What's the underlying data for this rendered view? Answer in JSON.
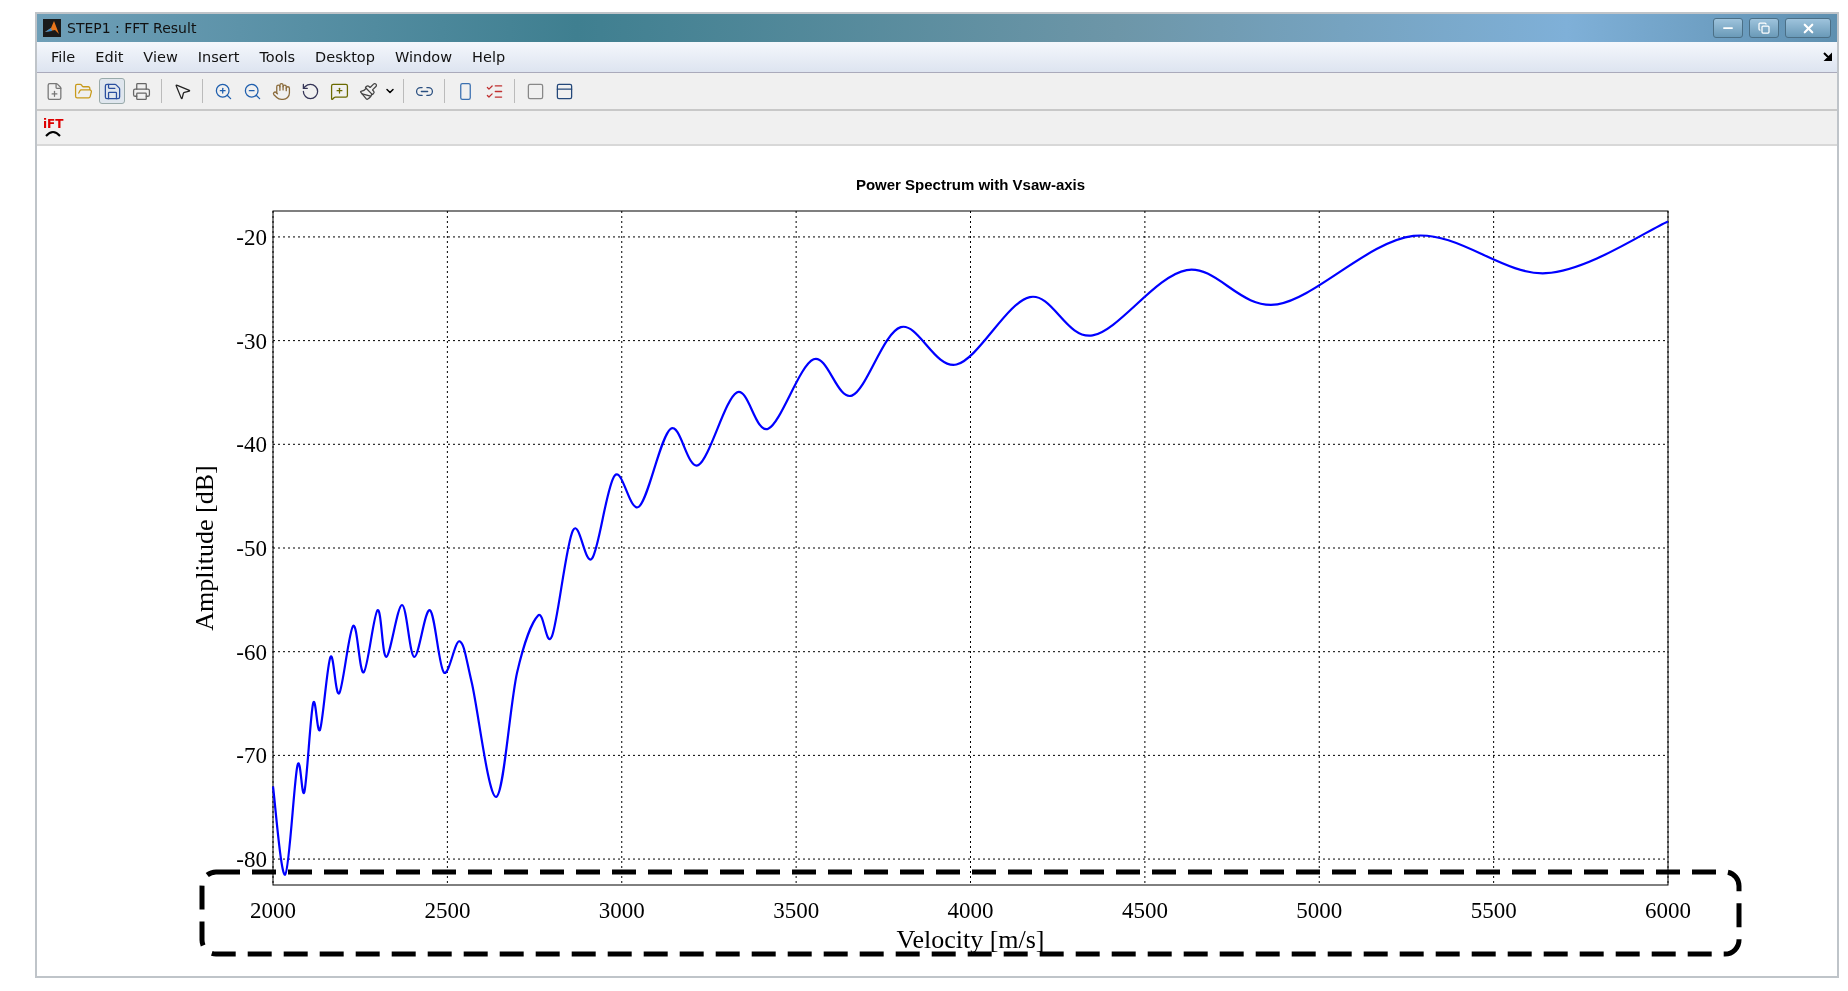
{
  "window": {
    "title": "STEP1 : FFT Result"
  },
  "menu": [
    "File",
    "Edit",
    "View",
    "Insert",
    "Tools",
    "Desktop",
    "Window",
    "Help"
  ],
  "toolbar2": {
    "logo_text": "iFT"
  },
  "figure": {
    "chart_data": {
      "type": "line",
      "title": "Power Spectrum with Vsaw-axis",
      "xlabel": "Velocity [m/s]",
      "ylabel": "Amplitude [dB]",
      "x": [
        2000,
        2035,
        2070,
        2090,
        2115,
        2135,
        2165,
        2190,
        2230,
        2260,
        2300,
        2325,
        2370,
        2405,
        2450,
        2490,
        2535,
        2570,
        2640,
        2700,
        2760,
        2800,
        2860,
        2915,
        2980,
        3050,
        3140,
        3220,
        3330,
        3420,
        3550,
        3660,
        3800,
        3960,
        4170,
        4350,
        4620,
        4880,
        5270,
        5650,
        6000
      ],
      "series": [
        {
          "color": "#0000ff",
          "values": [
            -73,
            -81.5,
            -71,
            -73.5,
            -65,
            -67.5,
            -60.5,
            -64,
            -57.5,
            -62,
            -56,
            -60.5,
            -55.5,
            -60.5,
            -56,
            -62,
            -59,
            -63,
            -74,
            -62,
            -56.5,
            -58.5,
            -48.3,
            -51,
            -43,
            -46,
            -38.5,
            -42,
            -35,
            -38.5,
            -31.8,
            -35.3,
            -28.7,
            -32.3,
            -25.8,
            -29.5,
            -23.2,
            -26.5,
            -19.9,
            -23.5,
            -18.5
          ]
        }
      ],
      "xlim": [
        2000,
        6000
      ],
      "ylim": [
        -82.5,
        -17.5
      ],
      "xticks": [
        2000,
        2500,
        3000,
        3500,
        4000,
        4500,
        5000,
        5500,
        6000
      ],
      "yticks": [
        -80,
        -70,
        -60,
        -50,
        -40,
        -30,
        -20
      ],
      "grid": true
    }
  }
}
